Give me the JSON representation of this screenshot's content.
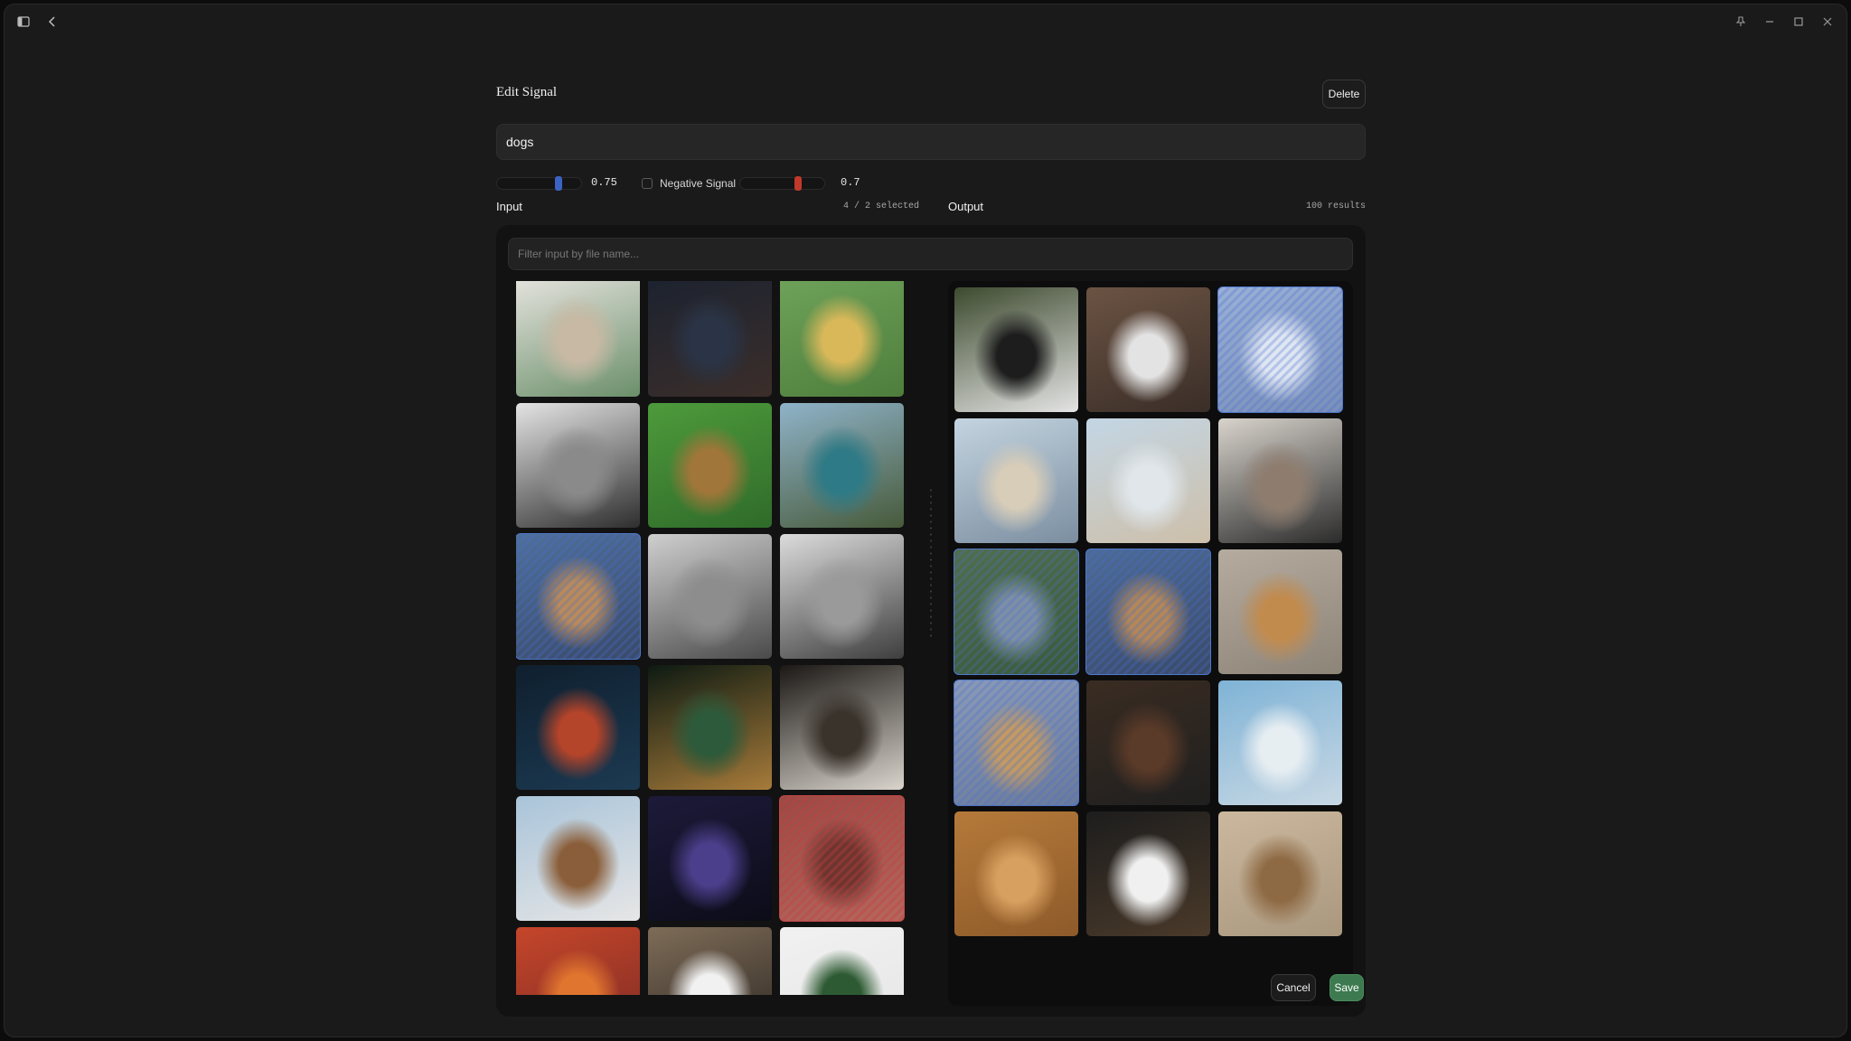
{
  "window": {
    "title_icons": [
      "sidebar-toggle-icon",
      "back-chevron-icon"
    ],
    "control_icons": [
      "pin-icon",
      "minimize-icon",
      "maximize-icon",
      "close-icon"
    ]
  },
  "dialog": {
    "title": "Edit Signal",
    "delete_label": "Delete",
    "query_value": "dogs",
    "positive_weight": "0.75",
    "negative_checkbox_label": "Negative Signal",
    "negative_weight": "0.7",
    "negative_checked": false,
    "input_label": "Input",
    "input_selection": "4 / 2 selected",
    "output_label": "Output",
    "output_count": "100 results",
    "filter_placeholder": "Filter input by file name...",
    "cancel_label": "Cancel",
    "save_label": "Save"
  },
  "colors": {
    "accent_blue": "#4f76c9",
    "accent_red": "#c14848",
    "save_green": "#3d7a4f"
  },
  "input_images": [
    {
      "name": "christmas-ornaments",
      "selection": "none",
      "colors": [
        "#e9e6e2",
        "#c7b9a3",
        "#6b8f6a"
      ]
    },
    {
      "name": "man-at-dusk",
      "selection": "none",
      "colors": [
        "#1b2230",
        "#2a3446",
        "#3b2e2a"
      ]
    },
    {
      "name": "woman-with-ball",
      "selection": "none",
      "colors": [
        "#6fa35a",
        "#d9b85a",
        "#4e7e3c"
      ]
    },
    {
      "name": "cliff-bw",
      "selection": "none",
      "colors": [
        "#e4e4e4",
        "#8a8a8a",
        "#2e2e2e"
      ]
    },
    {
      "name": "lion",
      "selection": "none",
      "colors": [
        "#4e9a3b",
        "#a1763a",
        "#2f6b2a"
      ]
    },
    {
      "name": "mountain-lake",
      "selection": "none",
      "colors": [
        "#8fb3c9",
        "#2e7a86",
        "#475a3a"
      ]
    },
    {
      "name": "corgi-on-rocks",
      "selection": "positive",
      "colors": [
        "#4f6f9a",
        "#b98a5a",
        "#3a4a6a"
      ]
    },
    {
      "name": "rio-bw",
      "selection": "none",
      "colors": [
        "#cfcfcf",
        "#8d8d8d",
        "#4a4a4a"
      ]
    },
    {
      "name": "sports-car",
      "selection": "none",
      "colors": [
        "#dcdcdc",
        "#9a9a9a",
        "#3e3e3e"
      ]
    },
    {
      "name": "city-night",
      "selection": "none",
      "colors": [
        "#0f1f2e",
        "#b4442a",
        "#1c3a52"
      ]
    },
    {
      "name": "bird-on-branch",
      "selection": "none",
      "colors": [
        "#0d1a12",
        "#2d5a3a",
        "#a77b3a"
      ]
    },
    {
      "name": "cave-dark",
      "selection": "none",
      "colors": [
        "#1b1815",
        "#3a332c",
        "#d9d4cc"
      ]
    },
    {
      "name": "snowy-mountains",
      "selection": "none",
      "colors": [
        "#a9c4d9",
        "#8a5e3a",
        "#e6e6e6"
      ]
    },
    {
      "name": "lightning",
      "selection": "none",
      "colors": [
        "#1d1a3a",
        "#4b3e8a",
        "#0c0c18"
      ]
    },
    {
      "name": "cat-red",
      "selection": "negative",
      "colors": [
        "#9a4a44",
        "#6e3530",
        "#b5675e"
      ]
    },
    {
      "name": "sunset-sky",
      "selection": "none",
      "colors": [
        "#c5462a",
        "#e0752f",
        "#7b2a25"
      ]
    },
    {
      "name": "tuxedo-cat",
      "selection": "none",
      "colors": [
        "#7e6c57",
        "#f1f1f1",
        "#2a2522"
      ]
    },
    {
      "name": "plant-white",
      "selection": "none",
      "colors": [
        "#f1f1f1",
        "#2d5a32",
        "#e5e5e5"
      ]
    }
  ],
  "output_images": [
    {
      "name": "border-collie-sitting",
      "selection": "none",
      "colors": [
        "#3d4a2e",
        "#1d1d1d",
        "#e4e4e4"
      ]
    },
    {
      "name": "husky-with-hand",
      "selection": "none",
      "colors": [
        "#6b5343",
        "#e3e3e3",
        "#3a2e28"
      ]
    },
    {
      "name": "samoyed-smile",
      "selection": "positive",
      "colors": [
        "#9ab0d6",
        "#dfe6f2",
        "#7a8fb9"
      ]
    },
    {
      "name": "dog-on-beach",
      "selection": "none",
      "colors": [
        "#c4d4e0",
        "#d8cdb9",
        "#7b8ea0"
      ]
    },
    {
      "name": "bench-by-sea",
      "selection": "none",
      "colors": [
        "#c3d6e4",
        "#e0e6ea",
        "#cdbfaa"
      ]
    },
    {
      "name": "woman-hugging-husky",
      "selection": "none",
      "colors": [
        "#d8d3cc",
        "#8e7d6f",
        "#2b2b2b"
      ]
    },
    {
      "name": "schnauzer-jumping",
      "selection": "positive",
      "colors": [
        "#516e4b",
        "#7d8fa6",
        "#3a5a3a"
      ]
    },
    {
      "name": "corgi-on-rocks-output",
      "selection": "positive",
      "colors": [
        "#4d6b96",
        "#b48757",
        "#3a4a6a"
      ]
    },
    {
      "name": "golden-puppy-ball",
      "selection": "none",
      "colors": [
        "#b5ab9e",
        "#c28b4e",
        "#8d8478"
      ]
    },
    {
      "name": "golden-retriever-fence",
      "selection": "positive",
      "colors": [
        "#8a9ab7",
        "#c49a62",
        "#6a7a9a"
      ]
    },
    {
      "name": "chocolate-lab",
      "selection": "none",
      "colors": [
        "#3a2c22",
        "#5a3a28",
        "#1f1f1f"
      ]
    },
    {
      "name": "dog-in-snow",
      "selection": "none",
      "colors": [
        "#7fb3d6",
        "#e7eef2",
        "#c8d8e4"
      ]
    },
    {
      "name": "golden-lying-down",
      "selection": "none",
      "colors": [
        "#b57a3a",
        "#d8a060",
        "#8e5a2a"
      ]
    },
    {
      "name": "collie-puppy",
      "selection": "none",
      "colors": [
        "#1d1d1d",
        "#f0f0f0",
        "#4a3a2a"
      ]
    },
    {
      "name": "dog-in-sand",
      "selection": "none",
      "colors": [
        "#cbb89e",
        "#8e6a44",
        "#a9977e"
      ]
    }
  ]
}
